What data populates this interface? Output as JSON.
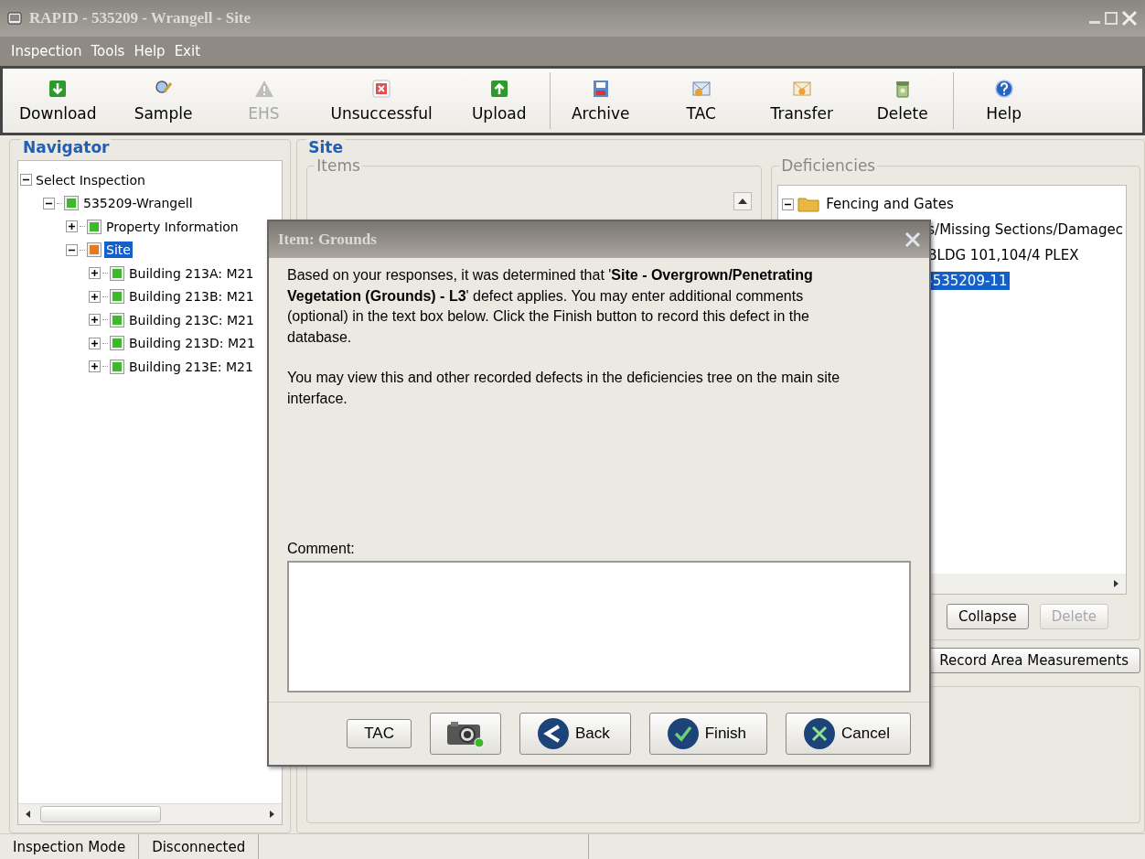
{
  "window": {
    "title": "RAPID - 535209 - Wrangell - Site"
  },
  "menu": [
    {
      "label": "Inspection"
    },
    {
      "label": "Tools"
    },
    {
      "label": "Help"
    },
    {
      "label": "Exit"
    }
  ],
  "toolbar_groups": [
    {
      "buttons": [
        {
          "label": "Download",
          "disabled": false
        },
        {
          "label": "Sample",
          "disabled": false
        },
        {
          "label": "EHS",
          "disabled": true
        },
        {
          "label": "Unsuccessful",
          "disabled": false
        },
        {
          "label": "Upload",
          "disabled": false
        }
      ]
    },
    {
      "buttons": [
        {
          "label": "Archive",
          "disabled": false
        },
        {
          "label": "TAC",
          "disabled": false
        },
        {
          "label": "Transfer",
          "disabled": false
        },
        {
          "label": "Delete",
          "disabled": false
        }
      ]
    },
    {
      "buttons": [
        {
          "label": "Help",
          "disabled": false
        }
      ]
    }
  ],
  "navigator": {
    "title": "Navigator",
    "tree": [
      {
        "label": "Select Inspection",
        "expanded": true,
        "selected": false,
        "children": [
          {
            "label": "535209-Wrangell",
            "expanded": true,
            "selected": false,
            "color": "#3cba2a",
            "children": [
              {
                "label": "Property Information",
                "expanded": false,
                "selected": false,
                "color": "#3cba2a"
              },
              {
                "label": "Site",
                "expanded": true,
                "selected": true,
                "color": "#e8781c",
                "children": [
                  {
                    "label": "Building 213A: M21",
                    "expanded": false,
                    "selected": false,
                    "color": "#3cba2a"
                  },
                  {
                    "label": "Building 213B: M21",
                    "expanded": false,
                    "selected": false,
                    "color": "#3cba2a"
                  },
                  {
                    "label": "Building 213C: M21",
                    "expanded": false,
                    "selected": false,
                    "color": "#3cba2a"
                  },
                  {
                    "label": "Building 213D: M21",
                    "expanded": false,
                    "selected": false,
                    "color": "#3cba2a"
                  },
                  {
                    "label": "Building 213E: M21",
                    "expanded": false,
                    "selected": false,
                    "color": "#3cba2a"
                  }
                ]
              }
            ]
          }
        ]
      }
    ]
  },
  "site": {
    "title": "Site",
    "items": {
      "title": "Items"
    },
    "deficiencies": {
      "title": "Deficiencies",
      "rows": [
        {
          "kind": "folder",
          "text": "Fencing and Gates",
          "selected": false
        },
        {
          "kind": "fragment",
          "text": "s/Missing Sections/Damagec",
          "selected": false
        },
        {
          "kind": "fragment",
          "text": "BLDG 101,104/4 PLEX",
          "selected": false
        },
        {
          "kind": "fragment",
          "text": "-535209-11",
          "selected": true
        }
      ],
      "buttons": [
        {
          "label": "Collapse",
          "disabled": false
        },
        {
          "label": "Delete",
          "disabled": true
        }
      ]
    },
    "record_button": "Record Area Measurements"
  },
  "dialog": {
    "title": "Item: Grounds",
    "paragraphs": [
      "Based on your responses, it was determined that '**Site - Overgrown/Penetrating Vegetation (Grounds) - L3**' defect applies. You may enter additional comments (optional) in the text box below. Click the Finish button to record this defect in the database.",
      "You may view this and other recorded defects in the deficiencies tree on the main site interface."
    ],
    "comment_label": "Comment:",
    "buttons": [
      {
        "kind": "plain",
        "label": "TAC"
      },
      {
        "kind": "camera"
      },
      {
        "kind": "back",
        "label": "Back"
      },
      {
        "kind": "finish",
        "label": "Finish"
      },
      {
        "kind": "cancel",
        "label": "Cancel"
      }
    ]
  },
  "status_bar": [
    "Inspection Mode",
    "Disconnected"
  ]
}
